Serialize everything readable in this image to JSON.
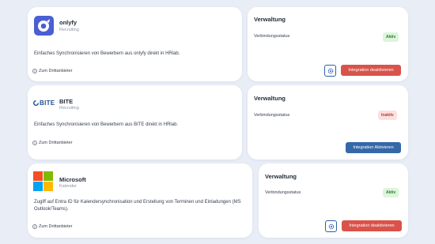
{
  "integrations": [
    {
      "name": "onlyfy",
      "category": "Recruiting",
      "description": "Einfaches Synchronisieren von Bewerbern aus onlyfy direkt in HRlab.",
      "third_party_link": "Zum Drittanbieter",
      "admin_title": "Verwaltung",
      "status_label": "Verbindungsstatus",
      "status": "Aktiv",
      "action_label": "Integration deaktivieren"
    },
    {
      "name": "BITE",
      "logo_text": "BITE",
      "category": "Recruiting",
      "description": "Einfaches Synchronisieren von Bewerbern aus BITE direkt in HRlab.",
      "third_party_link": "Zum Drittanbieter",
      "admin_title": "Verwaltung",
      "status_label": "Verbindungsstatus",
      "status": "Inaktiv",
      "action_label": "Integration Aktivieren"
    },
    {
      "name": "Microsoft",
      "category": "Kalender",
      "description": "Zugiff auf Entra ID für Kalendersynchronisation und Erstellung von Terminen und Einladungen (MS Outlook/Teams).",
      "third_party_link": "Zum Drittanbieter",
      "admin_title": "Verwaltung",
      "status_label": "Verbindungsstatus",
      "status": "Aktiv",
      "action_label": "Integration deaktivieren"
    }
  ],
  "icons": {
    "info": "info-icon",
    "gear": "gear-icon"
  },
  "colors": {
    "background": "#e8edf6",
    "active_badge": "#dcf5dc",
    "inactive_badge": "#fde0e0",
    "deactivate_button": "#d9534a",
    "activate_button": "#3568a8",
    "onlyfy_brand": "#4a5fd4"
  }
}
